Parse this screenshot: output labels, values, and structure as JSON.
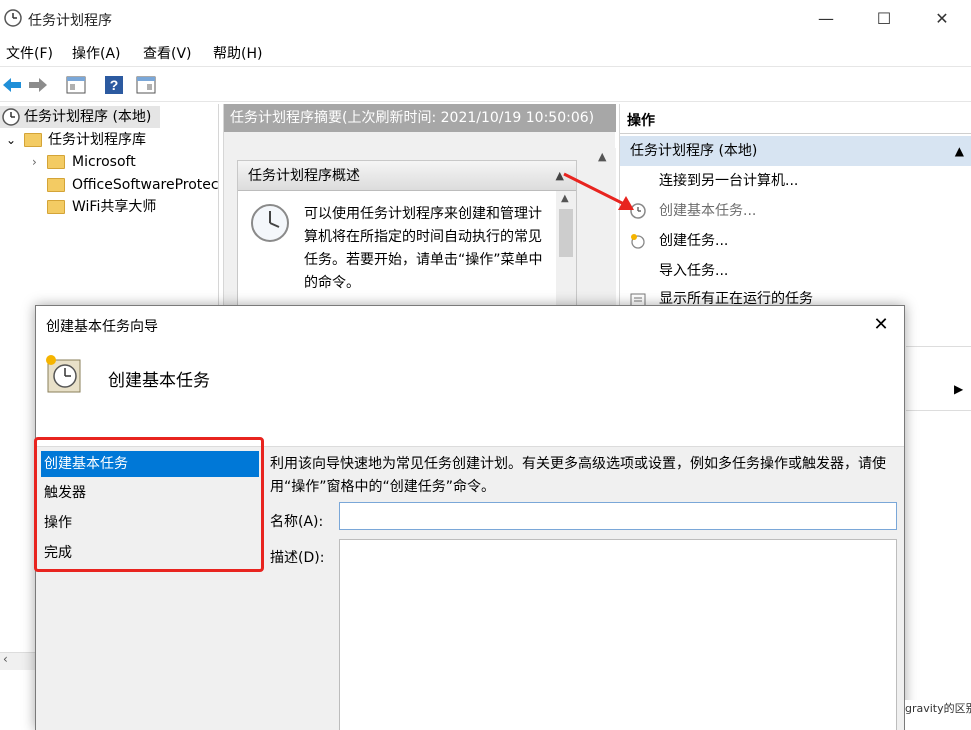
{
  "window": {
    "title": "任务计划程序",
    "minimize": "—",
    "maximize": "☐",
    "close": "✕"
  },
  "menu": [
    "文件(F)",
    "操作(A)",
    "查看(V)",
    "帮助(H)"
  ],
  "tree": {
    "root": "任务计划程序 (本地)",
    "library": "任务计划程序库",
    "children": [
      "Microsoft",
      "OfficeSoftwareProtec",
      "WiFi共享大师"
    ]
  },
  "middle": {
    "header": "任务计划程序摘要(上次刷新时间: 2021/10/19 10:50:06)",
    "section_title": "任务计划程序概述",
    "section_text": "可以使用任务计划程序来创建和管理计算机将在所指定的时间自动执行的常见任务。若要开始，请单击“操作”菜单中的命令。"
  },
  "actions": {
    "header": "操作",
    "group": "任务计划程序 (本地)",
    "items": [
      "连接到另一台计算机...",
      "创建基本任务...",
      "创建任务...",
      "导入任务...",
      "显示所有正在运行的任务"
    ]
  },
  "dialog": {
    "title": "创建基本任务向导",
    "close": "✕",
    "heading": "创建基本任务",
    "steps": [
      "创建基本任务",
      "触发器",
      "操作",
      "完成"
    ],
    "intro": "利用该向导快速地为常见任务创建计划。有关更多高级选项或设置，例如多任务操作或触发器，请使用“操作”窗格中的“创建任务”命令。",
    "name_label": "名称(A):",
    "name_value": "",
    "desc_label": "描述(D):",
    "desc_value": ""
  },
  "snippet": "gravity的区别",
  "colors": {
    "selection": "#0078d7",
    "highlight_red": "#e8241f",
    "actions_group": "#d7e4f2",
    "middle_header": "#a7a7a7"
  }
}
